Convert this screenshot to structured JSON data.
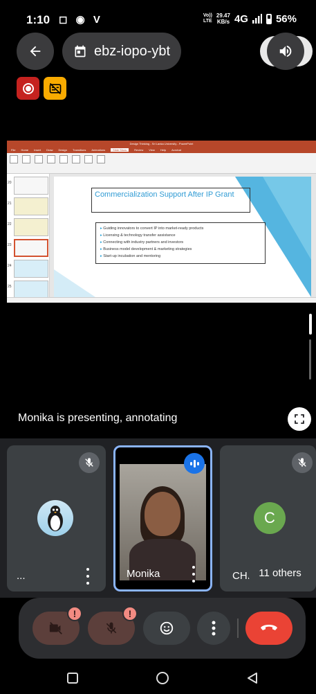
{
  "status_bar": {
    "time": "1:10",
    "left_icons": "◻ ◉ V",
    "volte_top": "Vo))",
    "volte_bottom": "LTE",
    "speed_value": "29.47",
    "speed_unit": "KB/s",
    "network": "4G",
    "battery": "56%",
    "battery_level": 0.56
  },
  "top_bar": {
    "meeting_code": "ebz-iopo-ybt"
  },
  "presentation": {
    "ppt_window_title": "Design Thinking - Sri Lanka University - PowerPoint",
    "ppt_tabs": [
      "File",
      "Home",
      "Insert",
      "Draw",
      "Design",
      "Transitions",
      "Animations",
      "Slide Show",
      "Review",
      "View",
      "Help",
      "Acrobat"
    ],
    "ppt_active_tab": "Slide Show",
    "thumbnail_numbers": [
      "20",
      "21",
      "22",
      "23",
      "24",
      "25"
    ],
    "slide_title": "Commercialization Support After IP Grant",
    "slide_bullets": [
      "Guiding innovators to convert IP into market-ready products",
      "Licensing & technology transfer assistance",
      "Connecting with industry partners and investors",
      "Business model development & marketing strategies",
      "Start-up incubation and mentoring"
    ]
  },
  "presenting_text": "Monika is presenting, annotating",
  "participants": [
    {
      "label": "...",
      "avatar": "penguin",
      "muted": true
    },
    {
      "label": "Monika",
      "avatar": "video",
      "speaking": true
    },
    {
      "label": "CHI",
      "avatar_letter": "C",
      "avatar_color": "#6aa84f",
      "muted": true
    }
  ],
  "others_chip": "11 others",
  "controls": {
    "camera_alert": "!",
    "mic_alert": "!"
  },
  "colors": {
    "end_call": "#ea4335",
    "speaking_blue": "#1a73e8",
    "active_border": "#8ab4f8",
    "record_red": "#c5221f",
    "captions_yellow": "#f9ab00"
  }
}
